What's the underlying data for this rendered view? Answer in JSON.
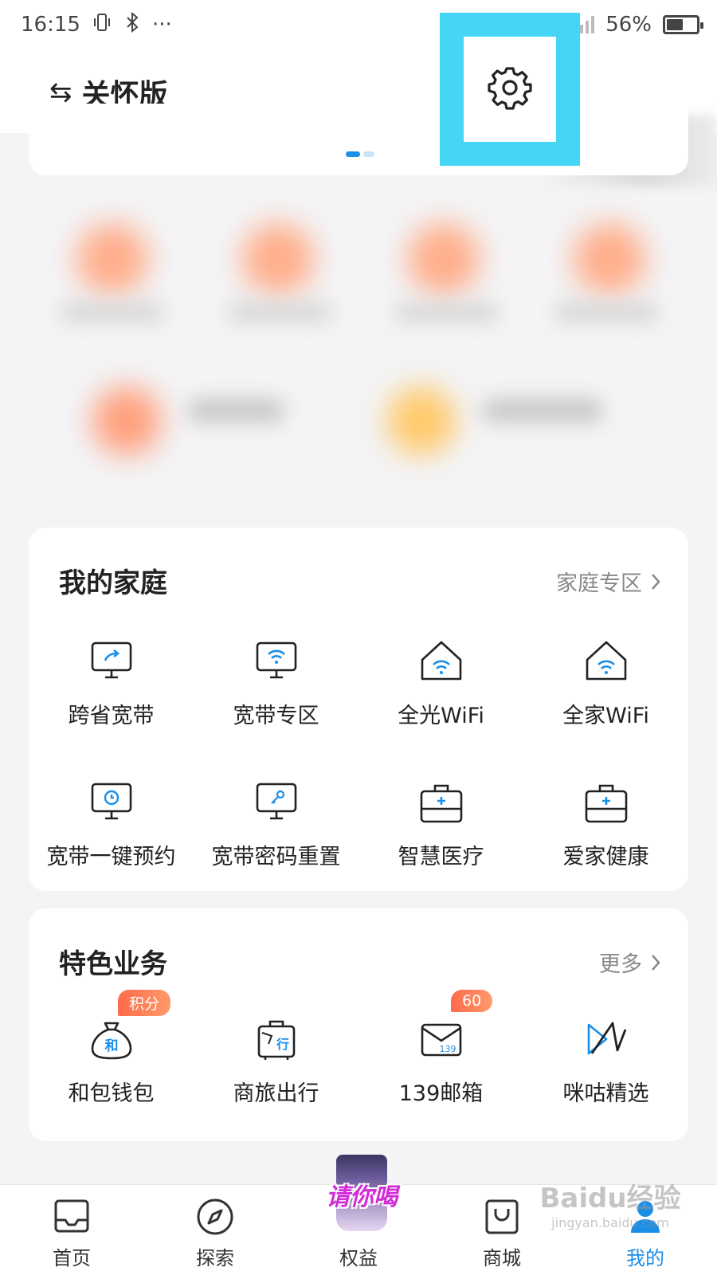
{
  "status_bar": {
    "time": "16:15",
    "dots": "···",
    "battery": "56%",
    "battery_level": 0.56
  },
  "header": {
    "care_mode_label": "关怀版",
    "swap_symbol": "⇆"
  },
  "banner": {
    "active_dot": 0,
    "dot_count": 2
  },
  "family_card": {
    "title": "我的家庭",
    "link_label": "家庭专区",
    "items": [
      {
        "label": "跨省宽带",
        "icon": "monitor-share-icon"
      },
      {
        "label": "宽带专区",
        "icon": "monitor-wifi-icon"
      },
      {
        "label": "全光WiFi",
        "icon": "house-wifi-icon"
      },
      {
        "label": "全家WiFi",
        "icon": "house-wifi-icon"
      },
      {
        "label": "宽带一键预约",
        "icon": "monitor-clock-icon"
      },
      {
        "label": "宽带密码重置",
        "icon": "monitor-key-icon"
      },
      {
        "label": "智慧医疗",
        "icon": "medical-kit-icon"
      },
      {
        "label": "爱家健康",
        "icon": "medical-kit-icon"
      }
    ]
  },
  "features_card": {
    "title": "特色业务",
    "link_label": "更多",
    "items": [
      {
        "label": "和包钱包",
        "icon": "money-bag-icon",
        "badge": "积分",
        "icon_text": "和"
      },
      {
        "label": "商旅出行",
        "icon": "suitcase-icon",
        "badge": "",
        "icon_text": "行"
      },
      {
        "label": "139邮箱",
        "icon": "mail-icon",
        "badge": "60",
        "icon_text": "139"
      },
      {
        "label": "咪咕精选",
        "icon": "migu-icon",
        "badge": ""
      }
    ]
  },
  "bottom_nav": {
    "items": [
      {
        "label": "首页",
        "icon": "home-icon",
        "active": false
      },
      {
        "label": "探索",
        "icon": "compass-icon",
        "active": false
      },
      {
        "label": "权益",
        "icon": "promo-icon",
        "active": false,
        "promo_text": "请你喝"
      },
      {
        "label": "商城",
        "icon": "shopping-bag-icon",
        "active": false
      },
      {
        "label": "我的",
        "icon": "profile-icon",
        "active": true
      }
    ]
  },
  "watermark": {
    "brand": "Baidu经验",
    "url": "jingyan.baidu.com"
  },
  "colors": {
    "accent_blue": "#1a8fe8",
    "highlight_frame": "#45d6f5",
    "badge_orange": "#ff7a55",
    "promo_magenta": "#d22bd6"
  }
}
